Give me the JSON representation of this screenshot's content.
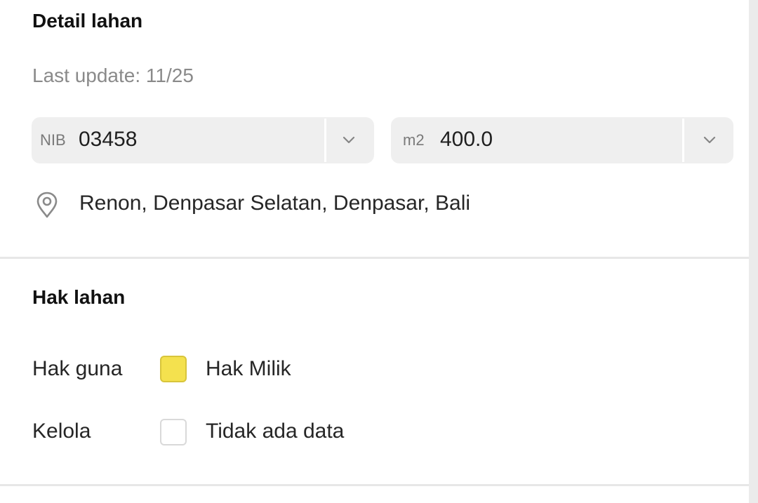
{
  "detail": {
    "title": "Detail lahan",
    "last_update": "Last update: 11/25",
    "nib": {
      "prefix": "NIB",
      "value": "03458"
    },
    "area": {
      "prefix": "m2",
      "value": "400.0"
    },
    "location": "Renon, Denpasar Selatan, Denpasar, Bali"
  },
  "rights": {
    "title": "Hak lahan",
    "rows": [
      {
        "label": "Hak guna",
        "value": "Hak Milik",
        "swatch_color": "#f4e14e"
      },
      {
        "label": "Kelola",
        "value": "Tidak ada data",
        "swatch_color": "#ffffff"
      }
    ]
  },
  "icons": {
    "location": "location-pin-icon",
    "dropdown": "chevron-down-icon"
  },
  "colors": {
    "field_background": "#efefef",
    "muted_text": "#8a8a8a",
    "divider": "#e7e7e7",
    "accent_yellow": "#f4e14e"
  }
}
